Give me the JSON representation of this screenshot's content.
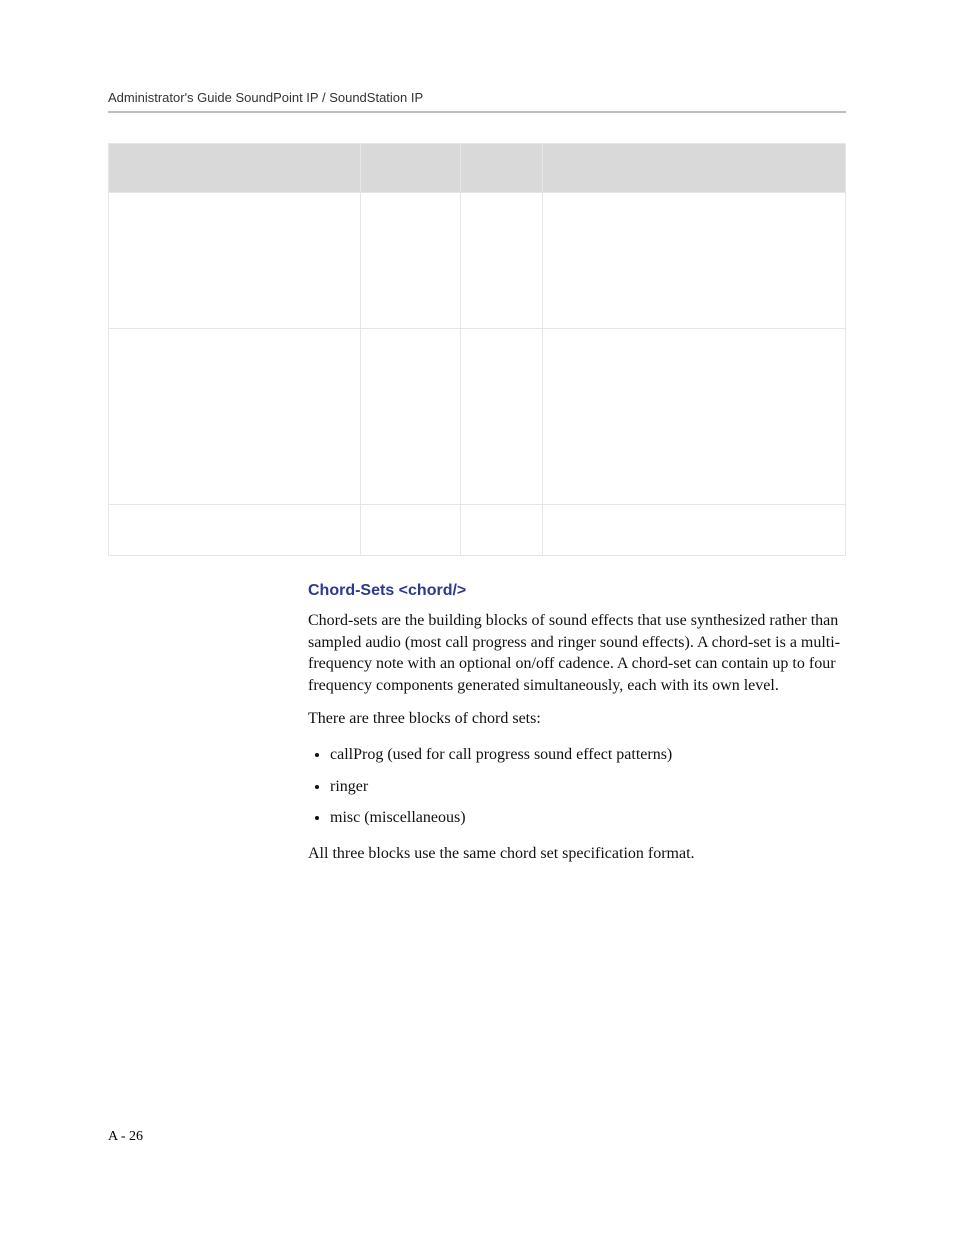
{
  "header": {
    "running_head": "Administrator's Guide SoundPoint IP / SoundStation IP"
  },
  "table": {
    "headers": [
      "",
      "",
      "",
      ""
    ],
    "rows": [
      [
        "",
        "",
        "",
        ""
      ],
      [
        "",
        "",
        "",
        ""
      ],
      [
        "",
        "",
        "",
        ""
      ]
    ]
  },
  "section": {
    "title": "Chord-Sets <chord/>",
    "para1": "Chord-sets are the building blocks of sound effects that use synthesized rather than sampled audio (most call progress and ringer sound effects). A chord-set is a multi-frequency note with an optional on/off cadence. A chord-set can contain up to four frequency components generated simultaneously, each with its own level.",
    "para2": "There are three blocks of chord sets:",
    "bullets": [
      "callProg (used for call progress sound effect patterns)",
      "ringer",
      "misc (miscellaneous)"
    ],
    "para3": "All three blocks use the same chord set specification format."
  },
  "footer": {
    "page_number": "A - 26"
  }
}
